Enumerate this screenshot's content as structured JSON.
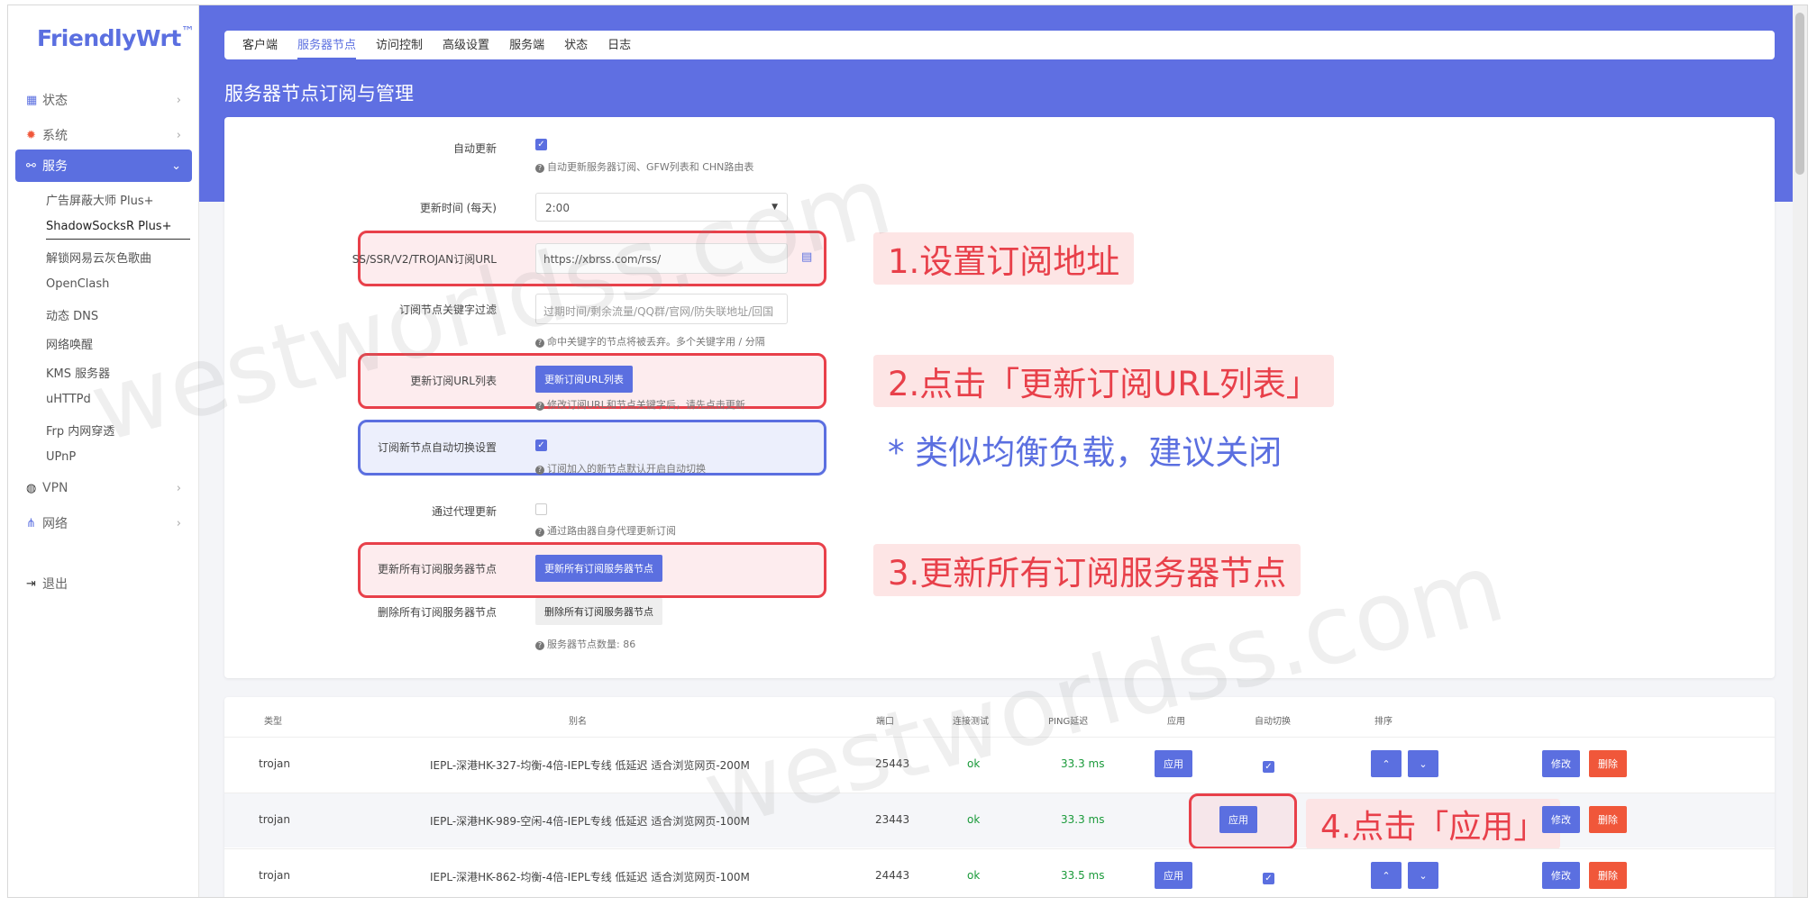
{
  "brand": {
    "name": "FriendlyWrt",
    "tm": "™"
  },
  "sidebar": {
    "items": [
      {
        "label": "状态",
        "icon": "grid-icon"
      },
      {
        "label": "系统",
        "icon": "gear-icon"
      },
      {
        "label": "服务",
        "icon": "link-icon"
      },
      {
        "label": "VPN",
        "icon": "globe-icon"
      },
      {
        "label": "网络",
        "icon": "network-icon"
      },
      {
        "label": "退出",
        "icon": "logout-icon"
      }
    ],
    "sub": [
      "广告屏蔽大师 Plus+",
      "ShadowSocksR Plus+",
      "解锁网易云灰色歌曲",
      "OpenClash",
      "动态 DNS",
      "网络唤醒",
      "KMS 服务器",
      "uHTTPd",
      "Frp 内网穿透",
      "UPnP"
    ]
  },
  "tabs": [
    "客户端",
    "服务器节点",
    "访问控制",
    "高级设置",
    "服务端",
    "状态",
    "日志"
  ],
  "page_title": "服务器节点订阅与管理",
  "form": {
    "auto_update_label": "自动更新",
    "auto_update_hint": "自动更新服务器订阅、GFW列表和 CHN路由表",
    "update_time_label": "更新时间 (每天)",
    "update_time_value": "2:00",
    "url_label": "SS/SSR/V2/TROJAN订阅URL",
    "url_value": "https://xbrss.com/rss/",
    "filter_label": "订阅节点关键字过滤",
    "filter_placeholder": "过期时间/剩余流量/QQ群/官网/防失联地址/回国",
    "filter_hint": "命中关键字的节点将被丢弃。多个关键字用 / 分隔",
    "update_url_label": "更新订阅URL列表",
    "update_url_button": "更新订阅URL列表",
    "update_url_hint": "修改订阅URL和节点关键字后，请先点击更新",
    "auto_switch_label": "订阅新节点自动切换设置",
    "auto_switch_hint": "订阅加入的新节点默认开启自动切换",
    "proxy_update_label": "通过代理更新",
    "proxy_update_hint": "通过路由器自身代理更新订阅",
    "update_all_label": "更新所有订阅服务器节点",
    "update_all_button": "更新所有订阅服务器节点",
    "delete_all_label": "删除所有订阅服务器节点",
    "delete_all_button": "删除所有订阅服务器节点",
    "node_count_hint": "服务器节点数量: 86"
  },
  "callouts": {
    "c1": "1.设置订阅地址",
    "c2": "2.点击「更新订阅URL列表」",
    "c3": "* 类似均衡负载，建议关闭",
    "c4": "3.更新所有订阅服务器节点",
    "c5": "4.点击「应用」"
  },
  "watermark": "westworldss.com",
  "table": {
    "headers": [
      "类型",
      "别名",
      "端口",
      "连接测试",
      "PING延迟",
      "应用",
      "自动切换",
      "排序"
    ],
    "apply_label": "应用",
    "edit_label": "修改",
    "delete_label": "删除",
    "up_glyph": "⌃",
    "down_glyph": "⌄",
    "rows": [
      {
        "type": "trojan",
        "alias": "IEPL-深港HK-327-均衡-4倍-IEPL专线 低延迟 适合浏览网页-200M",
        "port": "25443",
        "test": "ok",
        "ping": "33.3 ms",
        "auto": true
      },
      {
        "type": "trojan",
        "alias": "IEPL-深港HK-989-空闲-4倍-IEPL专线 低延迟 适合浏览网页-100M",
        "port": "23443",
        "test": "ok",
        "ping": "33.3 ms",
        "auto": false
      },
      {
        "type": "trojan",
        "alias": "IEPL-深港HK-862-均衡-4倍-IEPL专线 低延迟 适合浏览网页-100M",
        "port": "24443",
        "test": "ok",
        "ping": "33.5 ms",
        "auto": true
      }
    ]
  },
  "colors": {
    "accent": "#5b6fe0",
    "danger": "#f0573a",
    "highlight": "#e8404a"
  }
}
